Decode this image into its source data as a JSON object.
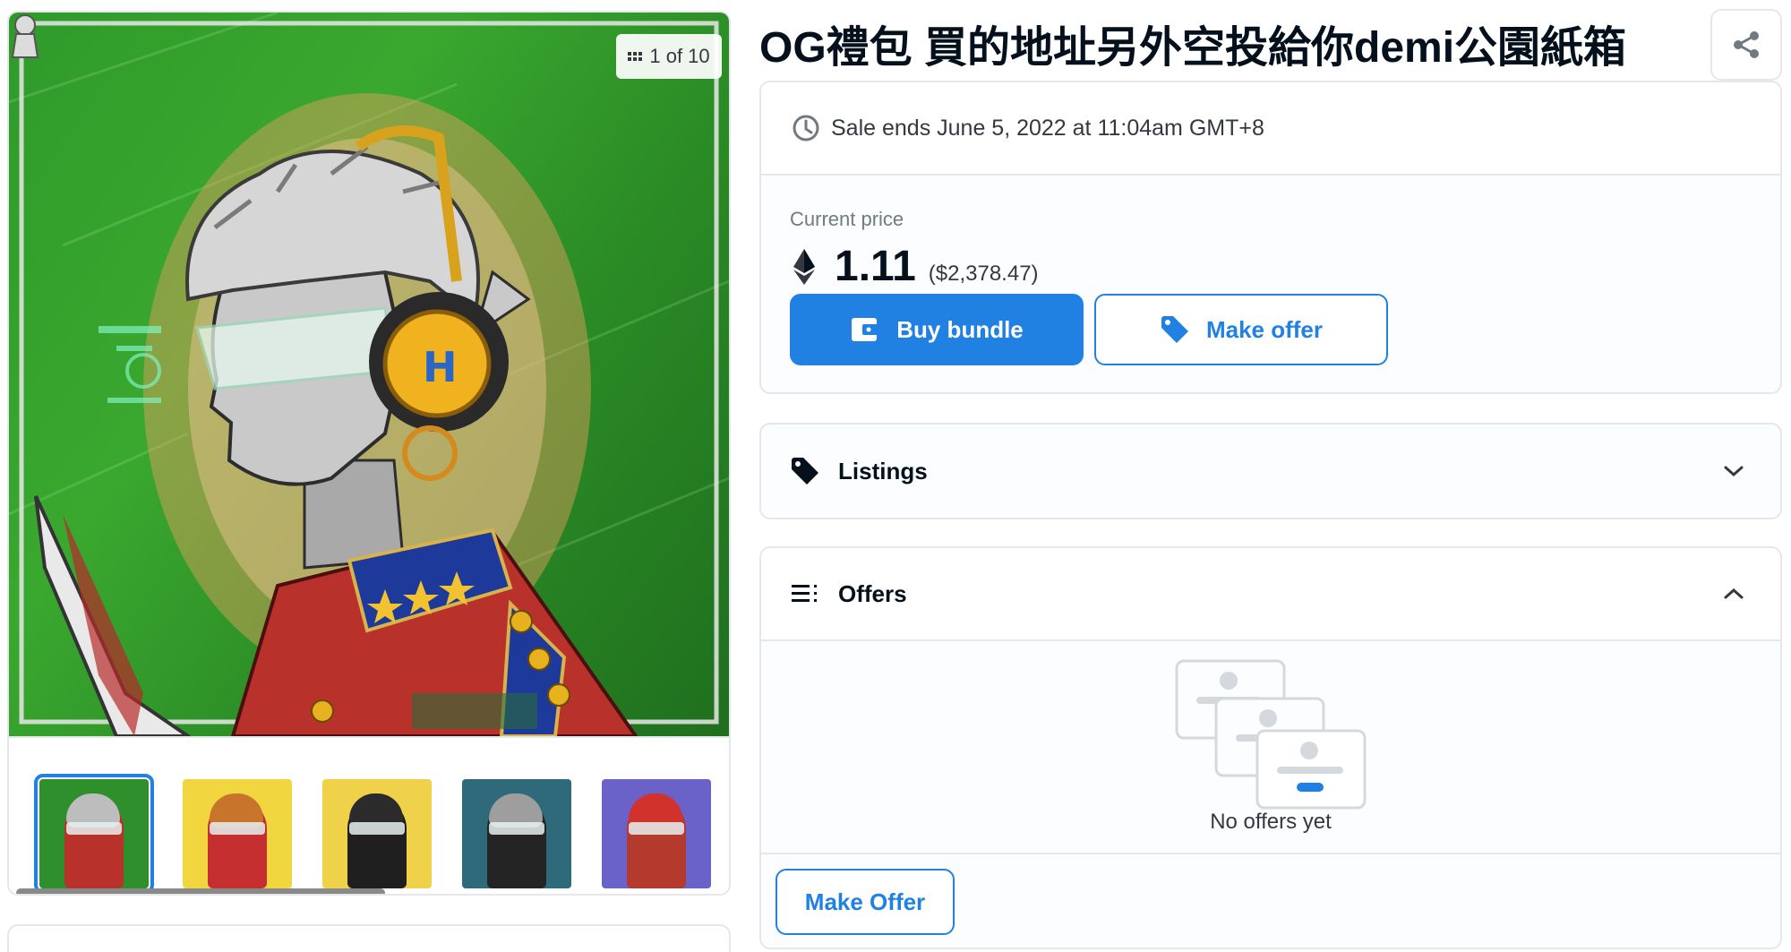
{
  "asset": {
    "title": "OG禮包 買的地址另外空投給你demi公園紙箱",
    "image_counter": "1 of 10"
  },
  "sale": {
    "ends_text": "Sale ends June 5, 2022 at 11:04am GMT+8",
    "price_label": "Current price",
    "price_eth": "1.11",
    "price_usd": "($2,378.47)",
    "buy_label": "Buy bundle",
    "offer_label": "Make offer"
  },
  "listings": {
    "label": "Listings",
    "expanded": false
  },
  "offers": {
    "label": "Offers",
    "expanded": true,
    "empty_text": "No offers yet",
    "make_offer_label": "Make Offer"
  },
  "thumbnails": [
    {
      "bg": "#2f8f2c",
      "hair": "#bdbdbd",
      "body": "#b8322b",
      "selected": true
    },
    {
      "bg": "#f2d640",
      "hair": "#c8742a",
      "body": "#c62f2f",
      "selected": false
    },
    {
      "bg": "#efd24a",
      "hair": "#2b2b2b",
      "body": "#1f1f1f",
      "selected": false
    },
    {
      "bg": "#2f6a7a",
      "hair": "#9e9e9e",
      "body": "#242424",
      "selected": false
    },
    {
      "bg": "#6a62c9",
      "hair": "#d1332c",
      "body": "#b33a2c",
      "selected": false
    }
  ],
  "colors": {
    "accent": "#2081e2",
    "border": "#e5e8eb",
    "text_primary": "#04111d",
    "text_secondary": "#707a83"
  },
  "icons": {
    "share": "share-icon",
    "clock": "clock-icon",
    "eth": "ethereum-icon",
    "wallet": "wallet-icon",
    "tag": "tag-icon",
    "list": "list-icon",
    "chevron_down": "chevron-down-icon",
    "chevron_up": "chevron-up-icon"
  }
}
